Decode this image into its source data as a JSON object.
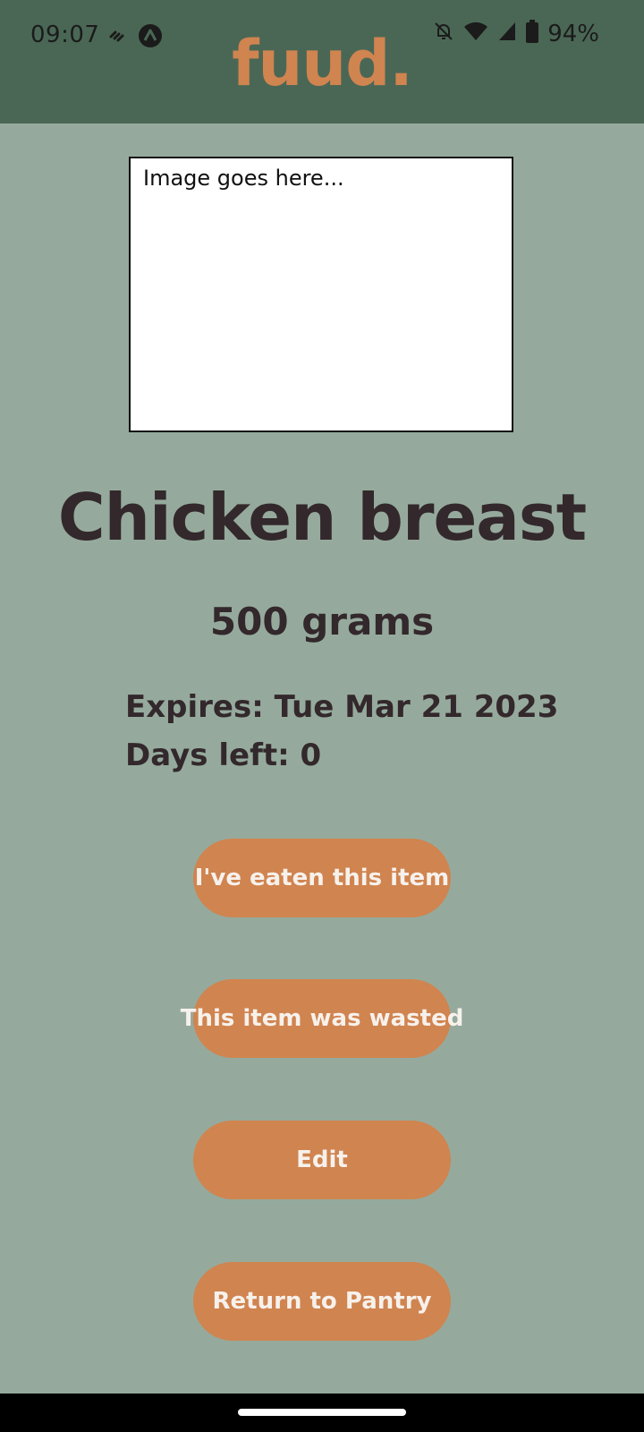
{
  "status_bar": {
    "time": "09:07",
    "battery_percent": "94%",
    "icons": [
      "link-icon",
      "notification-app-icon",
      "mute-icon",
      "wifi-icon",
      "signal-icon",
      "battery-icon"
    ]
  },
  "header": {
    "brand": "fuud."
  },
  "image_box": {
    "placeholder": "Image goes here..."
  },
  "item": {
    "name": "Chicken breast",
    "quantity": "500 grams",
    "expires": "Expires: Tue Mar 21 2023",
    "days_left": "Days left: 0"
  },
  "actions": {
    "eaten_label": "I've eaten this item",
    "wasted_label": "This item was wasted",
    "edit_label": "Edit",
    "return_label": "Return to Pantry"
  },
  "colors": {
    "header_bg": "#4a6755",
    "page_bg": "#95aa9d",
    "accent": "#d0844f",
    "text_dark": "#33282c"
  }
}
